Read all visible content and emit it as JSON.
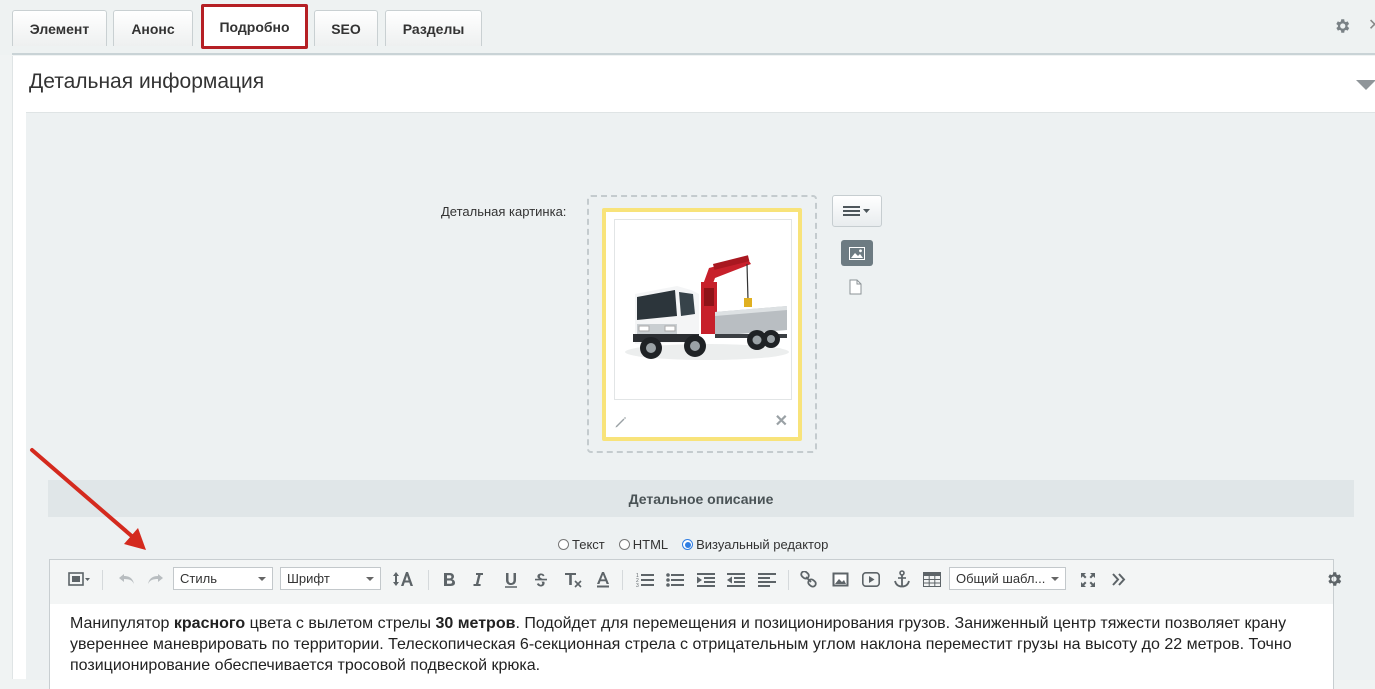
{
  "tabs": [
    {
      "label": "Элемент",
      "active": false
    },
    {
      "label": "Анонс",
      "active": false
    },
    {
      "label": "Подробно",
      "active": true
    },
    {
      "label": "SEO",
      "active": false
    },
    {
      "label": "Разделы",
      "active": false
    }
  ],
  "section": {
    "title": "Детальная информация"
  },
  "picture": {
    "label": "Детальная картинка:"
  },
  "description": {
    "header": "Детальное описание",
    "modes": [
      {
        "label": "Текст",
        "checked": false
      },
      {
        "label": "HTML",
        "checked": false
      },
      {
        "label": "Визуальный редактор",
        "checked": true
      }
    ]
  },
  "toolbar": {
    "style_select": "Стиль",
    "font_select": "Шрифт",
    "template_select": "Общий шабл..."
  },
  "content": {
    "p1": "Манипулятор ",
    "b1": "красного",
    "p2": " цвета с вылетом стрелы ",
    "b2": "30 метров",
    "p3": ". Подойдет для перемещения и позиционирования грузов. Заниженный центр тяжести позволяет крану увереннее маневрировать по территории. Телескопическая 6-секционная стрела с отрицательным углом наклона переместит грузы на высоту до 22 метров. Точно позиционирование обеспечивается тросовой подвеской крюка."
  },
  "colors": {
    "active_tab_border": "#b51f24",
    "annotation_arrow": "#d42a1e",
    "picture_frame": "#f8e37a"
  }
}
